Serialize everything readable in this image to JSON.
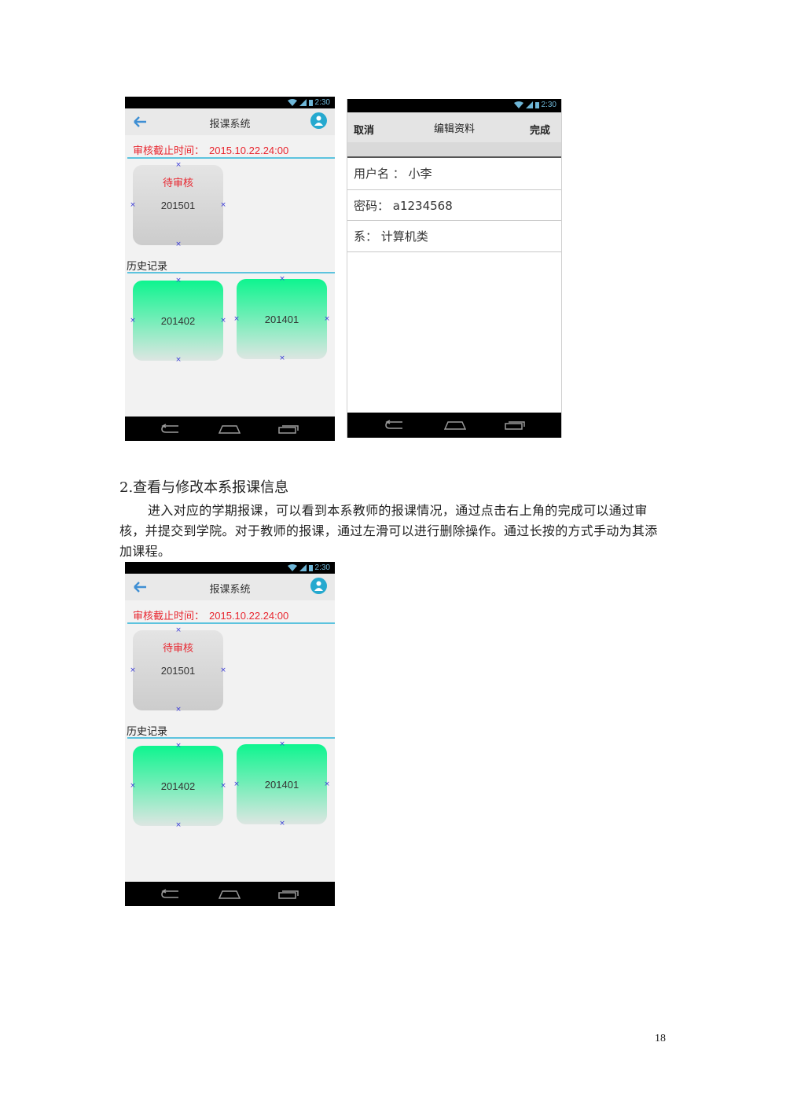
{
  "phone_status": {
    "time": "2:30"
  },
  "schedule_screen": {
    "title": "报课系统",
    "deadline_label": "审核截止时间：",
    "deadline_value": "2015.10.22.24:00",
    "pending_card": {
      "status": "待审核",
      "code": "201501"
    },
    "history_label": "历史记录",
    "history_cards": [
      {
        "code": "201402"
      },
      {
        "code": "201401"
      }
    ]
  },
  "edit_profile_screen": {
    "cancel_label": "取消",
    "title": "编辑资料",
    "done_label": "完成",
    "fields": [
      {
        "text": "用户名 ：   小李"
      },
      {
        "text": "密码：  a1234568"
      },
      {
        "text": "系：  计算机类"
      }
    ]
  },
  "document": {
    "heading": "2.查看与修改本系报课信息",
    "paragraph": "进入对应的学期报课，可以看到本系教师的报课情况，通过点击右上角的完成可以通过审核，并提交到学院。对于教师的报课，通过左滑可以进行删除操作。通过长按的方式手动为其添加课程。",
    "page_number": "18"
  },
  "colors": {
    "accent": "#5cc3de",
    "deadline_red": "#e8262f",
    "card_green": "#0ef58f",
    "avatar_blue": "#26a9cf"
  }
}
